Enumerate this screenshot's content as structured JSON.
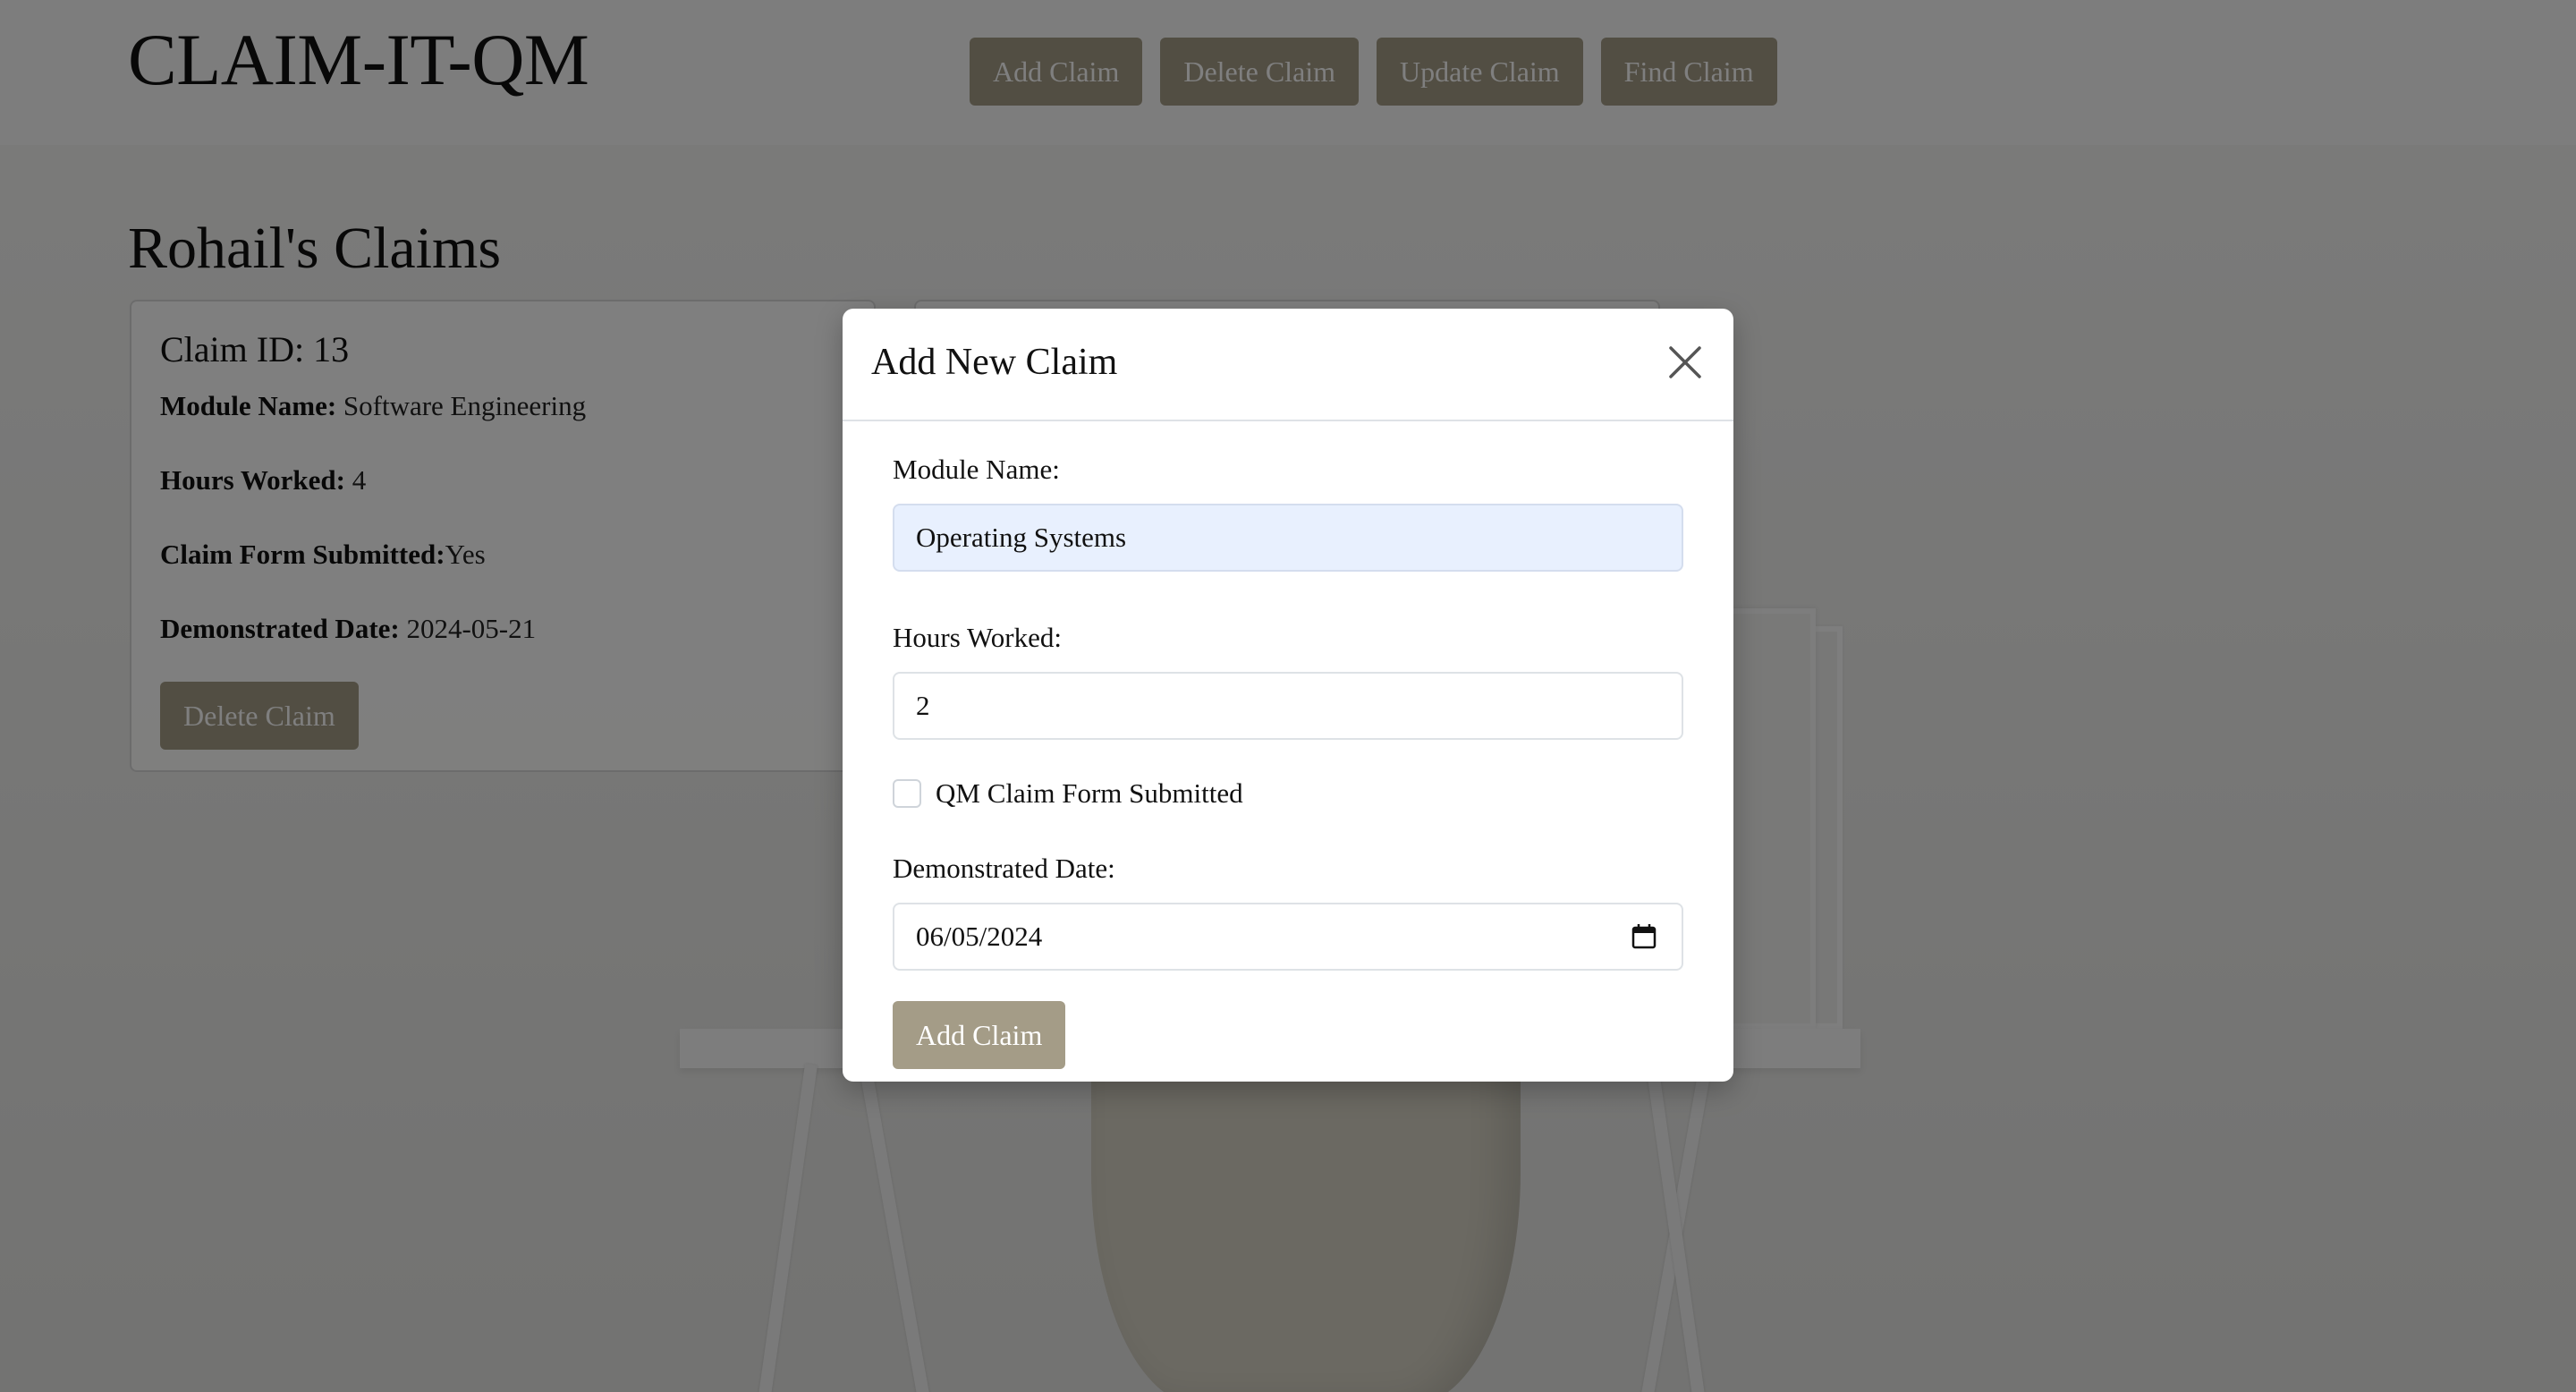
{
  "app": {
    "title": "CLAIM-IT-QM"
  },
  "nav": {
    "add": "Add Claim",
    "delete": "Delete Claim",
    "update": "Update Claim",
    "find": "Find Claim"
  },
  "main": {
    "section_title": "Rohail's Claims",
    "cards": [
      {
        "claim_id": "Claim ID: 13",
        "module_label": "Module Name:",
        "module_value": " Software Engineering",
        "hours_label": "Hours Worked:",
        "hours_value": " 4",
        "submitted_label": "Claim Form Submitted:",
        "submitted_value": "Yes",
        "date_label": "Demonstrated Date:",
        "date_value": " 2024-05-21",
        "delete_button": "Delete Claim"
      }
    ]
  },
  "modal": {
    "title": "Add New Claim",
    "module_label": "Module Name:",
    "module_value": "Operating Systems",
    "hours_label": "Hours Worked:",
    "hours_value": "2",
    "checkbox_label": "QM Claim Form Submitted",
    "checkbox_checked": false,
    "date_label": "Demonstrated Date:",
    "date_value": "06/05/2024",
    "submit_button": "Add Claim"
  },
  "colors": {
    "button": "#a49c87",
    "autofill": "#e8f0fe"
  },
  "icons": {
    "close": "close-icon",
    "calendar": "calendar-icon"
  }
}
